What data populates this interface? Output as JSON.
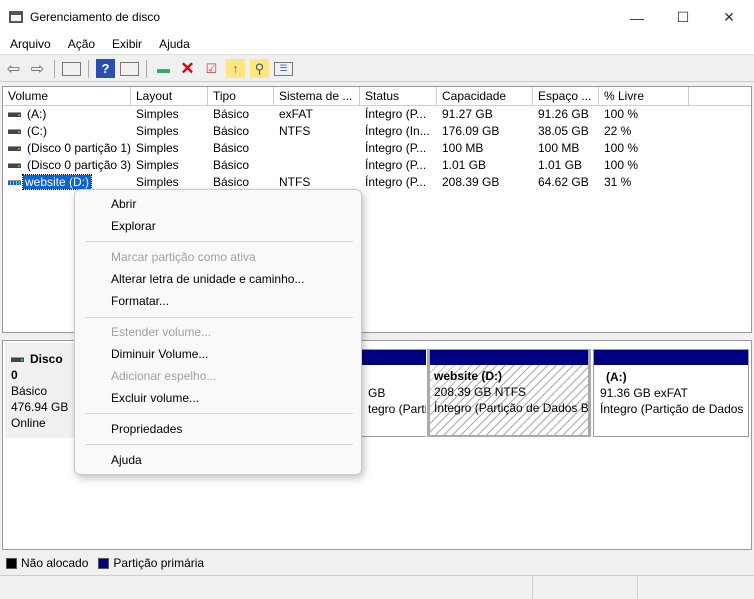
{
  "window": {
    "title": "Gerenciamento de disco",
    "minimize": "—",
    "maximize": "☐",
    "close": "✕"
  },
  "menubar": [
    "Arquivo",
    "Ação",
    "Exibir",
    "Ajuda"
  ],
  "toolbar": [
    "back-icon",
    "forward-icon",
    "console-tree-icon",
    "help-icon",
    "show-pane-icon",
    "connect-drive-icon",
    "delete-icon",
    "check-icon",
    "up-folder-icon",
    "search-folder-icon",
    "properties-list-icon"
  ],
  "columns": [
    "Volume",
    "Layout",
    "Tipo",
    "Sistema de ...",
    "Status",
    "Capacidade",
    "Espaço ...",
    "% Livre"
  ],
  "volumes": [
    [
      "(A:)",
      "Simples",
      "Básico",
      "exFAT",
      "Íntegro (P...",
      "91.27 GB",
      "91.26 GB",
      "100 %"
    ],
    [
      "(C:)",
      "Simples",
      "Básico",
      "NTFS",
      "Íntegro (In...",
      "176.09 GB",
      "38.05 GB",
      "22 %"
    ],
    [
      "(Disco 0 partição 1)",
      "Simples",
      "Básico",
      "",
      "Íntegro (P...",
      "100 MB",
      "100 MB",
      "100 %"
    ],
    [
      "(Disco 0 partição 3)",
      "Simples",
      "Básico",
      "",
      "Íntegro (P...",
      "1.01 GB",
      "1.01 GB",
      "100 %"
    ],
    [
      "website (D:)",
      "Simples",
      "Básico",
      "NTFS",
      "Íntegro (P...",
      "208.39 GB",
      "64.62 GB",
      "31 %"
    ]
  ],
  "selected_volume": "website (D:)",
  "disk": {
    "name": "Disco 0",
    "type": "Básico",
    "size": "476.94 GB",
    "status": "Online"
  },
  "partitions": [
    {
      "name": "",
      "line1": "GB",
      "line2": "tegro (Partiçã"
    },
    {
      "name": "website  (D:)",
      "line1": "208.39 GB NTFS",
      "line2": "Íntegro (Partição de Dados B"
    },
    {
      "name": "(A:)",
      "line1": "91.36 GB exFAT",
      "line2": "Íntegro (Partição de Dados"
    }
  ],
  "legend": [
    {
      "label": "Não alocado",
      "color": "#000000"
    },
    {
      "label": "Partição primária",
      "color": "#000080"
    }
  ],
  "context_menu": [
    {
      "label": "Abrir",
      "enabled": true
    },
    {
      "label": "Explorar",
      "enabled": true
    },
    {
      "label": "Marcar partição como ativa",
      "enabled": false
    },
    {
      "label": "Alterar letra de unidade e caminho...",
      "enabled": true
    },
    {
      "label": "Formatar...",
      "enabled": true
    },
    {
      "label": "Estender volume...",
      "enabled": false
    },
    {
      "label": "Diminuir Volume...",
      "enabled": true
    },
    {
      "label": "Adicionar espelho...",
      "enabled": false
    },
    {
      "label": "Excluir volume...",
      "enabled": true
    },
    {
      "label": "Propriedades",
      "enabled": true
    },
    {
      "label": "Ajuda",
      "enabled": true
    }
  ]
}
